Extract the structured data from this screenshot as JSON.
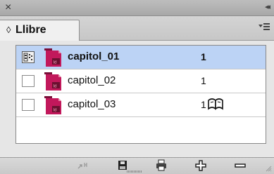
{
  "panel": {
    "close_icon": "×",
    "collapse_icon": "◂◂",
    "tab": {
      "arrows": "◊",
      "label": "Llibre"
    },
    "menu_icon": "panel-menu-icon"
  },
  "documents": [
    {
      "name": "capitol_01",
      "pages": "1",
      "selected": true,
      "style_source": true
    },
    {
      "name": "capitol_02",
      "pages": "1",
      "selected": false,
      "style_source": false
    },
    {
      "name": "capitol_03",
      "pages": "1",
      "selected": false,
      "style_source": false,
      "open_book": true
    }
  ],
  "toolbar": {
    "buttons": [
      "synchronize-icon",
      "save-book-icon",
      "print-book-icon",
      "add-document-icon",
      "remove-document-icon"
    ]
  },
  "colors": {
    "selection": "#bcd3f5",
    "indesign_icon": "#c2185b"
  }
}
